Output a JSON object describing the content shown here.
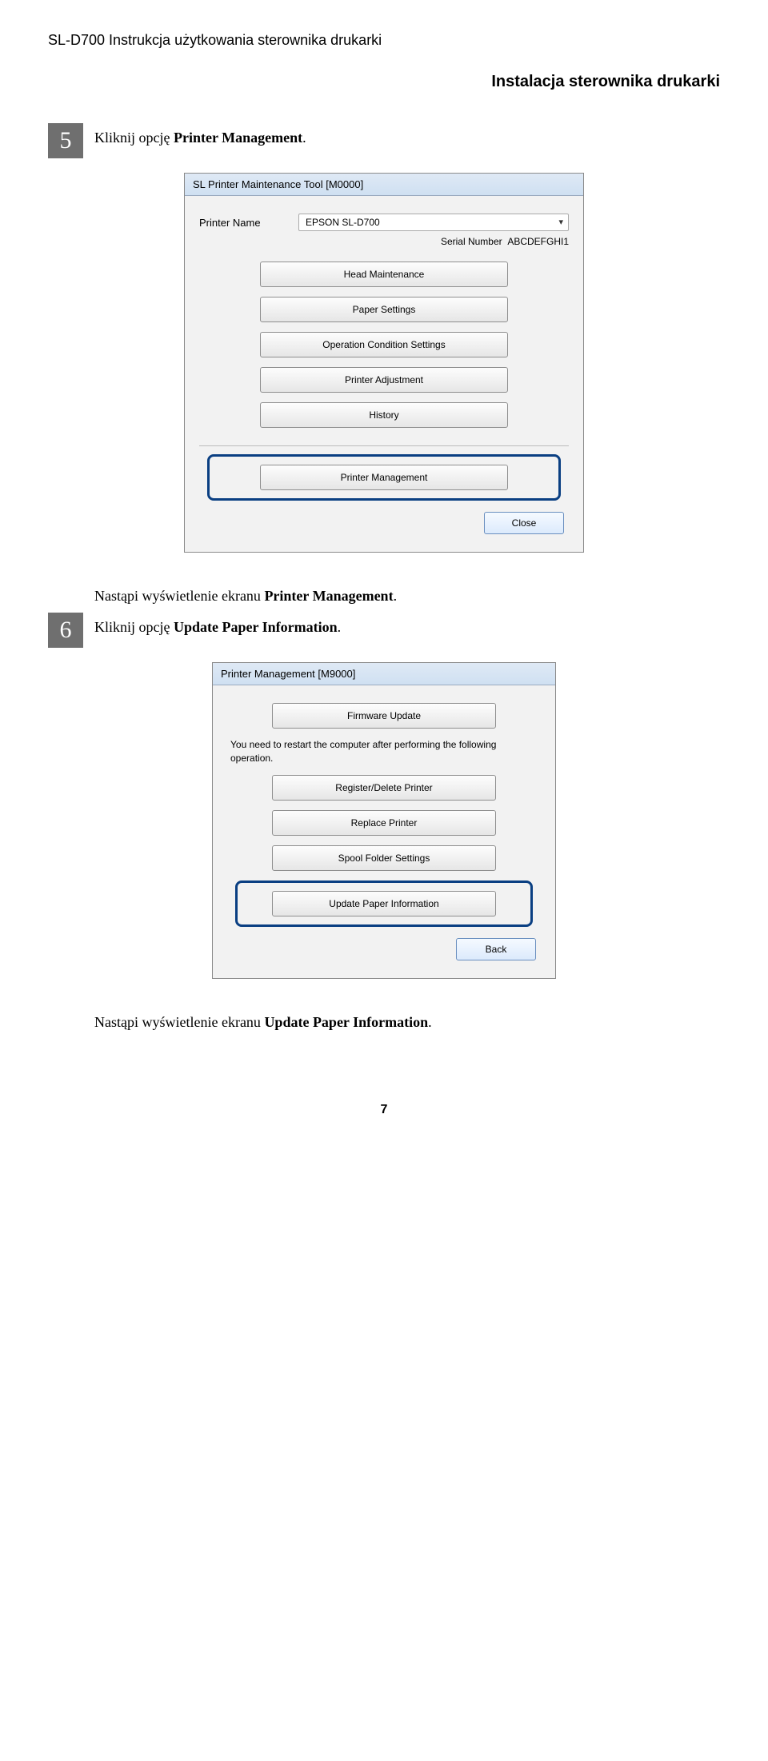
{
  "header": {
    "left": "SL-D700     Instrukcja użytkowania sterownika drukarki",
    "right": "Instalacja sterownika drukarki"
  },
  "step5": {
    "num": "5",
    "text_before": "Kliknij opcję ",
    "text_bold": "Printer Management",
    "text_after": "."
  },
  "win1": {
    "title": "SL Printer Maintenance Tool [M0000]",
    "printer_name_label": "Printer Name",
    "printer_name_value": "EPSON SL-D700",
    "serial_label": "Serial Number",
    "serial_value": "ABCDEFGHI1",
    "btn_head": "Head Maintenance",
    "btn_paper": "Paper Settings",
    "btn_ops": "Operation Condition Settings",
    "btn_adj": "Printer Adjustment",
    "btn_hist": "History",
    "btn_callout": "Printer Management",
    "btn_close": "Close"
  },
  "mid_text": {
    "before": "Nastąpi wyświetlenie ekranu ",
    "bold": "Printer Management",
    "after": "."
  },
  "step6": {
    "num": "6",
    "text_before": "Kliknij opcję ",
    "text_bold": "Update Paper Information",
    "text_after": "."
  },
  "win2": {
    "title": "Printer Management [M9000]",
    "btn_fw": "Firmware Update",
    "note": "You need to restart the computer after performing the following operation.",
    "btn_reg": "Register/Delete Printer",
    "btn_rep": "Replace Printer",
    "btn_spool": "Spool Folder Settings",
    "btn_callout": "Update Paper Information",
    "btn_back": "Back"
  },
  "bottom_text": {
    "before": "Nastąpi wyświetlenie ekranu ",
    "bold": "Update Paper Information",
    "after": "."
  },
  "page_number": "7"
}
